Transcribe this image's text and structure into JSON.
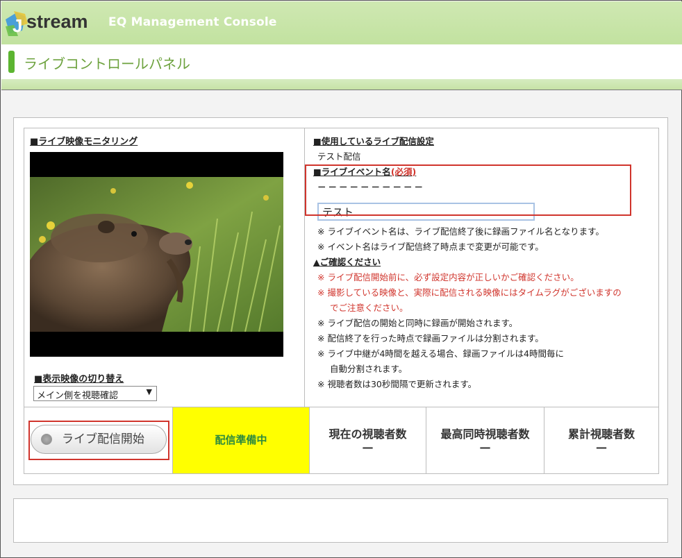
{
  "header": {
    "logo_text": "stream",
    "logo_letter": "J",
    "app_title": "EQ Management Console"
  },
  "page": {
    "title": "ライブコントロールパネル"
  },
  "monitor": {
    "heading": "■ライブ映像モニタリング",
    "switch_heading": "■表示映像の切り替え",
    "select_value": "メイン側を視聴確認",
    "select_arrow": "▼"
  },
  "settings": {
    "heading": "■使用しているライブ配信設定",
    "value": "テスト配信",
    "event_name_heading": "■ライブイベント名",
    "required_label": "(必須)",
    "event_name_dashes": "－－－－－－－－－－",
    "event_name_value": "テスト",
    "note1": "※ ライブイベント名は、ライブ配信終了後に録画ファイル名となります。",
    "note2": "※ イベント名はライブ配信終了時点まで変更が可能です。",
    "confirm_heading": "▲ご確認ください",
    "warn1": "※ ライブ配信開始前に、必ず設定内容が正しいかご確認ください。",
    "warn2a": "※ 撮影している映像と、実際に配信される映像にはタイムラグがございますの",
    "warn2b": "でご注意ください。",
    "info1": "※ ライブ配信の開始と同時に録画が開始されます。",
    "info2": "※ 配信終了を行った時点で録画ファイルは分割されます。",
    "info3a": "※ ライブ中継が4時間を越える場合、録画ファイルは4時間毎に",
    "info3b": "自動分割されます。",
    "info4": "※ 視聴者数は30秒間隔で更新されます。"
  },
  "controls": {
    "start_label": "ライブ配信開始",
    "status": "配信準備中",
    "stats": [
      {
        "label": "現在の視聴者数",
        "value": "—"
      },
      {
        "label": "最高同時視聴者数",
        "value": "—"
      },
      {
        "label": "累計視聴者数",
        "value": "—"
      }
    ]
  },
  "colors": {
    "header_green": "#c2e2a0",
    "accent_green": "#5cb531",
    "status_yellow": "#ffff00",
    "highlight_red": "#d0342c"
  }
}
